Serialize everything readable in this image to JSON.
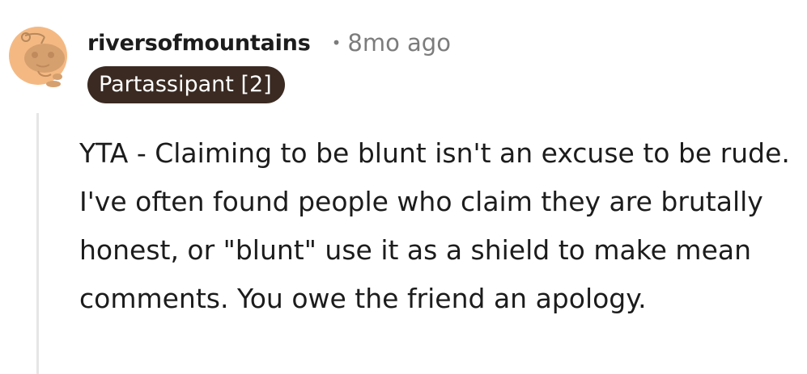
{
  "comment": {
    "author": {
      "username": "riversofmountains",
      "avatar_icon": "snoo-avatar-icon",
      "flair": "Partassipant [2]"
    },
    "separator": "•",
    "timestamp": "8mo ago",
    "body": "YTA - Claiming to be blunt isn't an excuse to be rude. I've often found people who claim they are brutally honest, or \"blunt\" use it as a shield to make mean comments. You owe the friend an apology."
  },
  "colors": {
    "avatar_background": "#f4b983",
    "flair_background": "#3a2a22",
    "thread_line": "#e6e6e6",
    "meta_text": "#7c7c7c"
  }
}
